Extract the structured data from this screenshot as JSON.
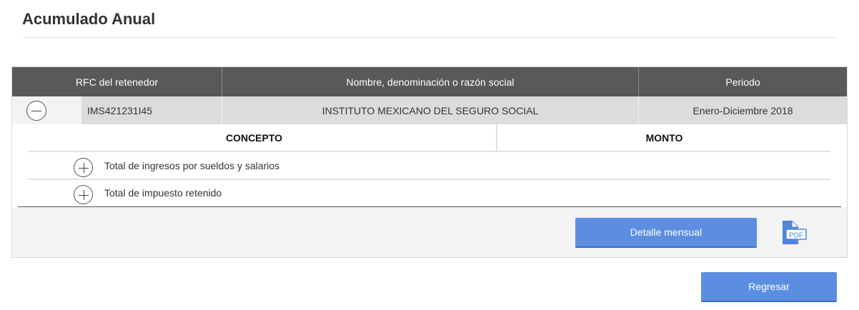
{
  "page": {
    "title": "Acumulado Anual"
  },
  "table": {
    "headers": {
      "rfc": "RFC del retenedor",
      "nombre": "Nombre, denominación o razón social",
      "periodo": "Periodo"
    },
    "rows": [
      {
        "rfc": "IMS421231I45",
        "nombre": "INSTITUTO MEXICANO DEL SEGURO SOCIAL",
        "periodo": "Enero-Diciembre 2018",
        "expanded": true
      }
    ]
  },
  "detail": {
    "headers": {
      "concepto": "CONCEPTO",
      "monto": "MONTO"
    },
    "items": [
      {
        "label": "Total de ingresos por sueldos y salarios",
        "icon": "plus-circle-icon"
      },
      {
        "label": "Total de impuesto retenido",
        "icon": "plus-circle-icon"
      }
    ]
  },
  "actions": {
    "detalle_label": "Detalle mensual",
    "pdf_icon": "pdf-file-icon",
    "regresar_label": "Regresar"
  },
  "colors": {
    "header_bg": "#595959",
    "accent": "#5b8ee0",
    "row_bg": "#dcdcdc",
    "panel_bg": "#f3f3f3"
  }
}
